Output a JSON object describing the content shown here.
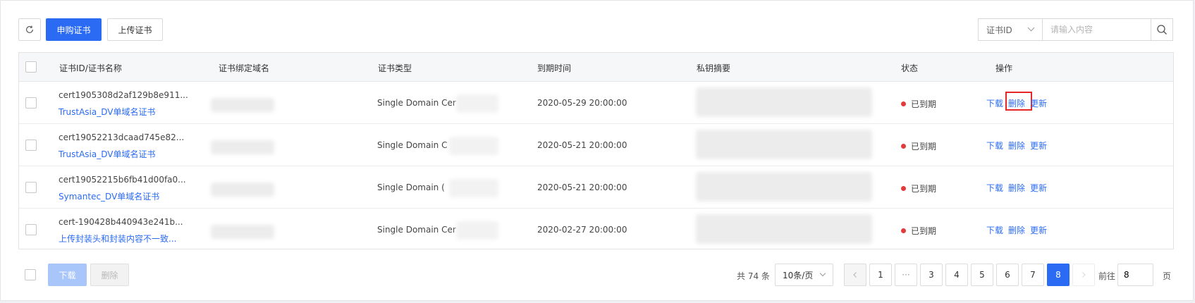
{
  "toolbar": {
    "buy_label": "申购证书",
    "upload_label": "上传证书"
  },
  "search": {
    "field_selected": "证书ID",
    "placeholder": "请输入内容"
  },
  "table": {
    "headers": {
      "id_name": "证书ID/证书名称",
      "domain": "证书绑定域名",
      "type": "证书类型",
      "expiry": "到期时间",
      "key_digest": "私钥摘要",
      "status": "状态",
      "actions": "操作"
    },
    "rows": [
      {
        "id": "cert1905308d2af129b8e911...",
        "name": "TrustAsia_DV单域名证书",
        "type": "Single Domain Cer",
        "expiry": "2020-05-29 20:00:00",
        "status": "已到期",
        "action_download": "下载",
        "action_delete": "删除",
        "action_renew": "更新"
      },
      {
        "id": "cert19052213dcaad745e82...",
        "name": "TrustAsia_DV单域名证书",
        "type": "Single Domain C",
        "expiry": "2020-05-21 20:00:00",
        "status": "已到期",
        "action_download": "下载",
        "action_delete": "删除",
        "action_renew": "更新"
      },
      {
        "id": "cert19052215b6fb41d00fa0...",
        "name": "Symantec_DV单域名证书",
        "type": "Single Domain (",
        "expiry": "2020-05-21 20:00:00",
        "status": "已到期",
        "action_download": "下载",
        "action_delete": "删除",
        "action_renew": "更新"
      },
      {
        "id": "cert-190428b440943e241b...",
        "name": "上传封装头和封装内容不一致...",
        "type": "Single Domain Cer",
        "expiry": "2020-02-27 20:00:00",
        "status": "已到期",
        "action_download": "下载",
        "action_delete": "删除",
        "action_renew": "更新"
      }
    ]
  },
  "footer": {
    "download_label": "下载",
    "delete_label": "删除",
    "total_text": "共 74 条",
    "page_size": "10条/页",
    "pages": [
      "1",
      "···",
      "3",
      "4",
      "5",
      "6",
      "7",
      "8"
    ],
    "current_page": "8",
    "goto_label": "前往",
    "goto_value": "8",
    "page_suffix": "页"
  },
  "colors": {
    "primary": "#2b6bf3",
    "status_expired": "#e23b3b",
    "highlight": "#e52727"
  },
  "icons": {
    "refresh": "refresh-icon",
    "search": "search-icon",
    "prev": "chevron-left-icon",
    "next": "chevron-right-icon"
  }
}
